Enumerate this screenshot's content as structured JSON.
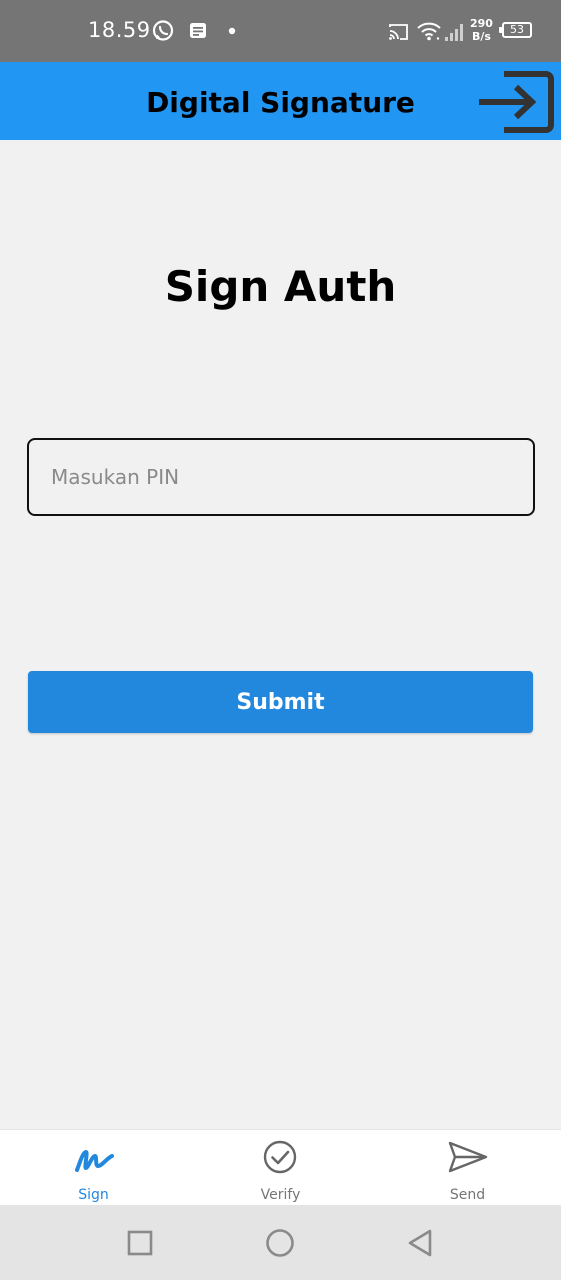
{
  "status_bar": {
    "time": "18.59",
    "net_speed_value": "290",
    "net_speed_unit": "B/s",
    "battery_level": "53",
    "icons": [
      "whatsapp-icon",
      "message-icon",
      "dot-icon",
      "cast-icon",
      "wifi-icon",
      "signal-icon",
      "battery-icon"
    ]
  },
  "app_bar": {
    "title": "Digital Signature",
    "action_icon": "login-icon",
    "background": "#2196f3"
  },
  "main": {
    "heading": "Sign Auth",
    "pin_input": {
      "value": "",
      "placeholder": "Masukan PIN"
    },
    "submit_label": "Submit",
    "accent": "#2288dd"
  },
  "bottom_nav": {
    "tabs": [
      {
        "label": "Sign",
        "icon": "signature-icon",
        "active": true
      },
      {
        "label": "Verify",
        "icon": "check-circle-icon",
        "active": false
      },
      {
        "label": "Send",
        "icon": "send-icon",
        "active": false
      }
    ]
  },
  "system_nav": {
    "buttons": [
      "recents-square-icon",
      "home-circle-icon",
      "back-triangle-icon"
    ]
  }
}
